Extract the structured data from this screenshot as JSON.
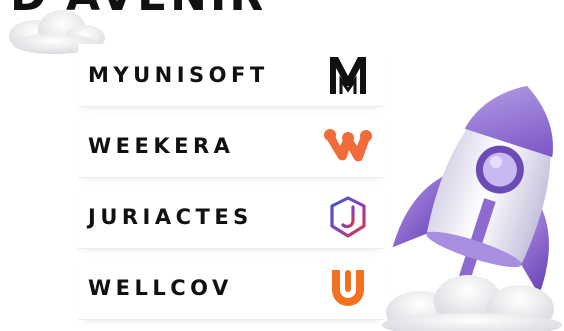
{
  "heading": "D'AVENIR",
  "brands": [
    {
      "name": "MYUNISOFT",
      "logo_icon": "myunisoft-logo-icon",
      "color": "#111111"
    },
    {
      "name": "WEEKERA",
      "logo_icon": "weekera-logo-icon",
      "color": "#f26b3a"
    },
    {
      "name": "JURIACTES",
      "logo_icon": "juriactes-logo-icon",
      "color": "#3f57c7"
    },
    {
      "name": "WELLCOV",
      "logo_icon": "wellcov-logo-icon",
      "color": "#f2701e"
    }
  ],
  "decor": {
    "rocket_icon": "rocket-icon",
    "cloud_icon": "cloud-icon",
    "rocket_color": "#9b7bd6"
  }
}
